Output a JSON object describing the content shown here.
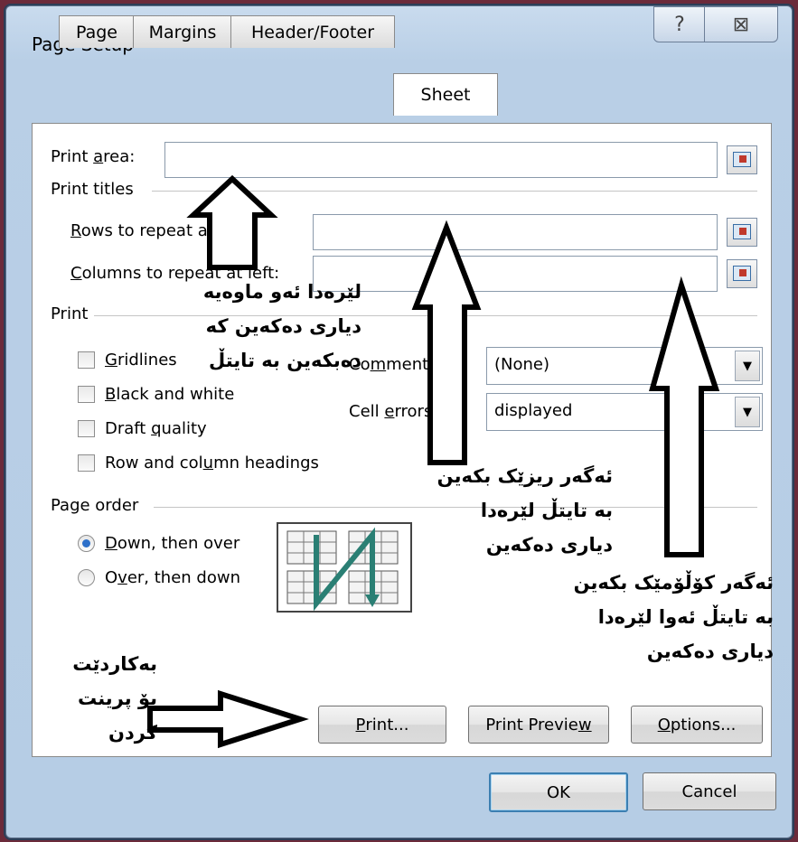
{
  "dialog": {
    "title": "Page Setup",
    "help_glyph": "?",
    "close_glyph": "⊠"
  },
  "tabs": [
    {
      "label": "Page"
    },
    {
      "label": "Margins"
    },
    {
      "label": "Header/Footer"
    },
    {
      "label": "Sheet",
      "active": true
    }
  ],
  "print_area": {
    "label_pre": "Print ",
    "label_u": "a",
    "label_post": "rea:",
    "value": ""
  },
  "print_titles": {
    "heading": "Print titles",
    "rows_label_u": "R",
    "rows_label_post": "ows to repeat at top:",
    "cols_label_u": "C",
    "cols_label_post": "olumns to repeat at left:"
  },
  "print_section": {
    "heading": "Print",
    "gridlines_u": "G",
    "gridlines_post": "ridlines",
    "bw_u": "B",
    "bw_post": "lack and white",
    "draft_pre": "Draft ",
    "draft_u": "q",
    "draft_post": "uality",
    "headings_pre": "Row and col",
    "headings_u": "u",
    "headings_post": "mn headings",
    "comments_pre": "Co",
    "comments_u": "m",
    "comments_post": "ments:",
    "comments_value": "(None)",
    "errors_pre": "Cell ",
    "errors_u": "e",
    "errors_post": "rrors as:",
    "errors_value": "displayed"
  },
  "page_order": {
    "heading": "Page order",
    "down_u": "D",
    "down_post": "own, then over",
    "over_pre": "O",
    "over_u": "v",
    "over_post": "er, then down",
    "selected": "down_then_over"
  },
  "buttons": {
    "print_u": "P",
    "print_post": "rint...",
    "preview_pre": "Print Previe",
    "preview_u": "w",
    "options_u": "O",
    "options_post": "ptions...",
    "ok": "OK",
    "cancel": "Cancel"
  },
  "annotations": {
    "a1_l1": "لێرەدا ئەو ماوەیە",
    "a1_l2": "دیاری دەکەین کە",
    "a1_l3": "دەبکەین بە تایتڵ",
    "a2_l1": "ئەگەر ریزێک بکەین",
    "a2_l2": "بە تایتڵ لێرەدا",
    "a2_l3": "دیاری دەکەین",
    "a3_l1": "ئەگەر کۆڵۆمێک بکەین",
    "a3_l2": "بە تایتڵ ئەوا لێرەدا",
    "a3_l3": "دیاری دەکەین",
    "a4_l1": "بەکاردێت",
    "a4_l2": "بۆ پرینت",
    "a4_l3": "کردن"
  },
  "colors": {
    "accent_radio": "#2c6fc9",
    "order_arrow": "#2a7f74",
    "default_button_border": "#3c7fb1"
  }
}
